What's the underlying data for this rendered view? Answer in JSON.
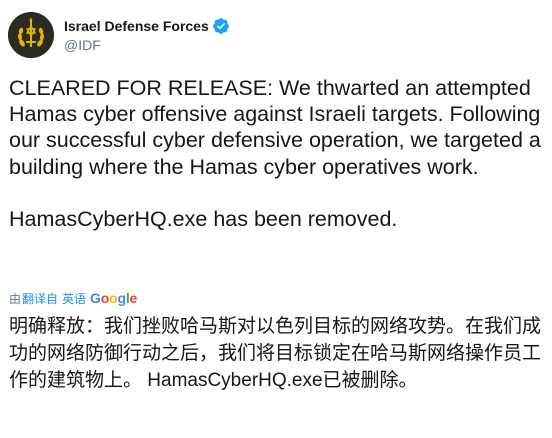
{
  "author": {
    "display_name": "Israel Defense Forces",
    "handle": "@IDF",
    "verified": true,
    "avatar_icon": "idf-emblem-icon"
  },
  "tweet": {
    "paragraph1": "CLEARED FOR RELEASE: We thwarted an attempted Hamas cyber offensive against Israeli targets. Following our successful cyber defensive operation, we targeted a building where the Hamas cyber operatives work.",
    "paragraph2": "HamasCyberHQ.exe has been removed."
  },
  "translate": {
    "prefix": "由",
    "link": "翻译自",
    "language": "英语",
    "provider": "Google"
  },
  "translation": {
    "text": "明确释放：我们挫败哈马斯对以色列目标的网络攻势。在我们成功的网络防御行动之后，我们将目标锁定在哈马斯网络操作员工作的建筑物上。 HamasCyberHQ.exe已被删除。"
  },
  "colors": {
    "text": "#14171a",
    "secondary": "#657786",
    "link": "#1b95e0",
    "verified": "#1da1f2"
  }
}
